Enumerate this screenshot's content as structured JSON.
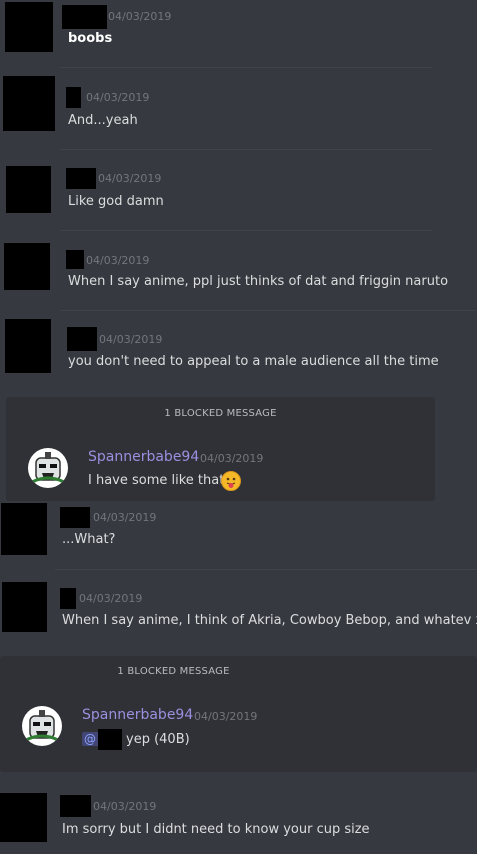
{
  "messages": [
    {
      "timestamp": "04/03/2019",
      "text": "boobs"
    },
    {
      "timestamp": "04/03/2019",
      "text": "And...yeah"
    },
    {
      "timestamp": "04/03/2019",
      "text": "Like god damn"
    },
    {
      "timestamp": "04/03/2019",
      "text": "When I say anime, ppl just thinks of dat and friggin naruto"
    },
    {
      "timestamp": "04/03/2019",
      "text": "you don't need to appeal to a male audience all the time"
    },
    {
      "timestamp": "04/03/2019",
      "text": "...What?"
    },
    {
      "timestamp": "04/03/2019",
      "text": "When I say anime, I think of Akria, Cowboy Bebop, and whatev xD"
    },
    {
      "timestamp": "04/03/2019",
      "text": "Im sorry but I didnt need to know your cup size"
    }
  ],
  "blocked_groups": [
    {
      "label": "1 BLOCKED MESSAGE",
      "username": "Spannerbabe94",
      "timestamp": "04/03/2019",
      "text": "I have some like that",
      "emoji": "tongue-out-emoji"
    },
    {
      "label": "1 BLOCKED MESSAGE",
      "username": "Spannerbabe94",
      "timestamp": "04/03/2019",
      "mention_prefix": "@",
      "text": "yep (40B)"
    }
  ],
  "colors": {
    "background": "#36393f",
    "blocked_bg": "#2f3136",
    "username": "#9b8fe0",
    "timestamp": "#72767d",
    "text": "#dcddde"
  }
}
